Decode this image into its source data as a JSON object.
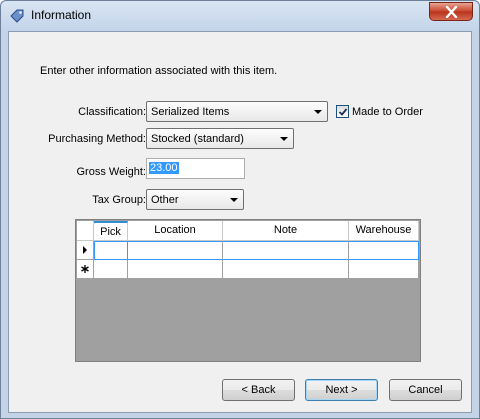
{
  "window": {
    "title": "Information",
    "accent": "#3c7fb1"
  },
  "intro_text": "Enter other information associated with this item.",
  "classification": {
    "label": "Classification:",
    "value": "Serialized Items"
  },
  "made_to_order": {
    "label": "Made to Order",
    "checked": true
  },
  "purchasing_method": {
    "label": "Purchasing Method:",
    "value": "Stocked (standard)"
  },
  "gross_weight": {
    "label": "Gross Weight:",
    "value": "23.00"
  },
  "tax_group": {
    "label": "Tax Group:",
    "value": "Other"
  },
  "grid": {
    "columns": [
      "Pick",
      "Location",
      "Note",
      "Warehouse"
    ],
    "rows": [
      {
        "marker": "current-row",
        "cells": [
          "",
          "",
          "",
          ""
        ]
      },
      {
        "marker": "new-row",
        "cells": [
          "",
          "",
          "",
          ""
        ]
      }
    ]
  },
  "buttons": {
    "back": "< Back",
    "next": "Next >",
    "cancel": "Cancel"
  }
}
